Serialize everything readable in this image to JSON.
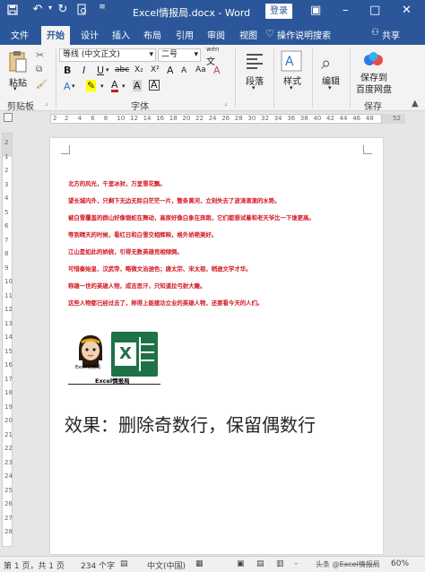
{
  "titlebar": {
    "title": "Excel情报局.docx - Word",
    "login": "登录"
  },
  "tabs": [
    "文件",
    "开始",
    "设计",
    "插入",
    "布局",
    "引用",
    "审阅",
    "视图"
  ],
  "active_tab": "开始",
  "search_label": "操作说明搜索",
  "share_label": "共享",
  "ribbon": {
    "clipboard": {
      "paste": "粘贴",
      "group": "剪贴板"
    },
    "font": {
      "name": "等线 (中文正文)",
      "size": "二号",
      "wen": "wén",
      "group": "字体",
      "bold": "B",
      "italic": "I",
      "underline": "U",
      "strike": "abc",
      "subscript": "X₂",
      "superscript": "X²",
      "grow": "A",
      "shrink": "A",
      "case": "Aa",
      "clear": "A",
      "highlight": "A",
      "color": "A",
      "shade": "A",
      "border": "A"
    },
    "paragraph": {
      "label": "段落"
    },
    "styles": {
      "label": "样式"
    },
    "editing": {
      "label": "编辑"
    },
    "save": {
      "line1": "保存到",
      "line2": "百度网盘",
      "group": "保存"
    }
  },
  "ruler": {
    "numbers": [
      "2",
      "2",
      "4",
      "6",
      "8",
      "10",
      "12",
      "14",
      "16",
      "18",
      "20",
      "22",
      "24",
      "26",
      "28",
      "30",
      "32",
      "34",
      "36",
      "38",
      "40",
      "42",
      "44",
      "46",
      "48",
      "52"
    ]
  },
  "vruler": {
    "numbers": [
      "2",
      "1",
      "2",
      "3",
      "4",
      "5",
      "6",
      "7",
      "8",
      "9",
      "10",
      "11",
      "12",
      "13",
      "14",
      "15",
      "16",
      "17",
      "18",
      "19",
      "20",
      "21",
      "22",
      "23",
      "24",
      "25",
      "26",
      "27",
      "28"
    ]
  },
  "document": {
    "paragraphs": [
      "北方的风光，千里冰封，万里雪花飘。",
      "望长城内外，只剩下无边无际白茫茫一片，整条黄河，立刻失去了波涛滚滚的水势。",
      "被白雪覆盖的群山好像银蛇在舞动，高原好像白象在奔跑，它们都想试着和老天爷比一下谁更高。",
      "等到晴天的时候，看红日和白雪交相辉映，格外娇艳美好。",
      "江山是如此的娇娆，引得无数英雄竞相倾倒。",
      "可惜秦始皇、汉武帝，略微文治逊色；唐太宗、宋太祖，稍逊文学才华。",
      "称雄一世的英雄人物，成吉思汗，只知道拉弓射大雕。",
      "这些人物都已经过去了，称得上能建功立业的英雄人物，还要看今天的人们。"
    ],
    "logo_caption": "Excel情报局",
    "logo_sub": "Excel情报局",
    "excel_letter": "X",
    "effect": "效果：删除奇数行，保留偶数行"
  },
  "status": {
    "page": "第 1 页，共 1 页",
    "words": "234 个字",
    "lang": "中文(中国)",
    "watermark": "头条 @Excel情报局",
    "zoom": "60%"
  },
  "colors": {
    "accent": "#2b579a",
    "text_red": "#d1141f",
    "excel_green": "#1f7246"
  }
}
